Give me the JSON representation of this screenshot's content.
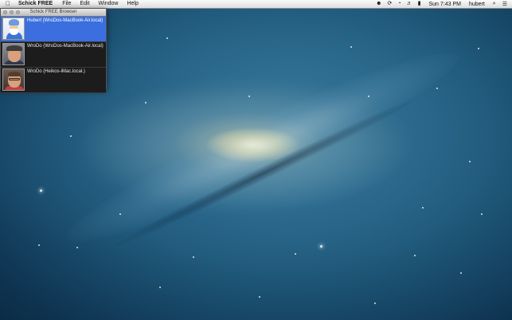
{
  "menubar": {
    "apple_icon": "apple-icon",
    "app_name": "Schick FREE",
    "menus": [
      "File",
      "Edit",
      "Window",
      "Help"
    ],
    "status_icons": [
      "user-icon",
      "sync-icon",
      "wifi-icon",
      "volume-icon",
      "battery-icon"
    ],
    "clock": "Sun 7:43 PM",
    "user": "hubert",
    "spotlight_icon": "search-icon",
    "notification_icon": "list-icon"
  },
  "window": {
    "title": "Schick FREE Browser",
    "rows": [
      {
        "label": "Hubert (WroDos-MacBook-Air.local)",
        "selected": true
      },
      {
        "label": "WroDo (WroDos-MacBook-Air.local)",
        "selected": false
      },
      {
        "label": "WroDo (Heikos-iMac.local.)",
        "selected": false
      }
    ]
  },
  "colors": {
    "selection": "#3b6fe0",
    "window_bg": "#1c1c1c"
  }
}
